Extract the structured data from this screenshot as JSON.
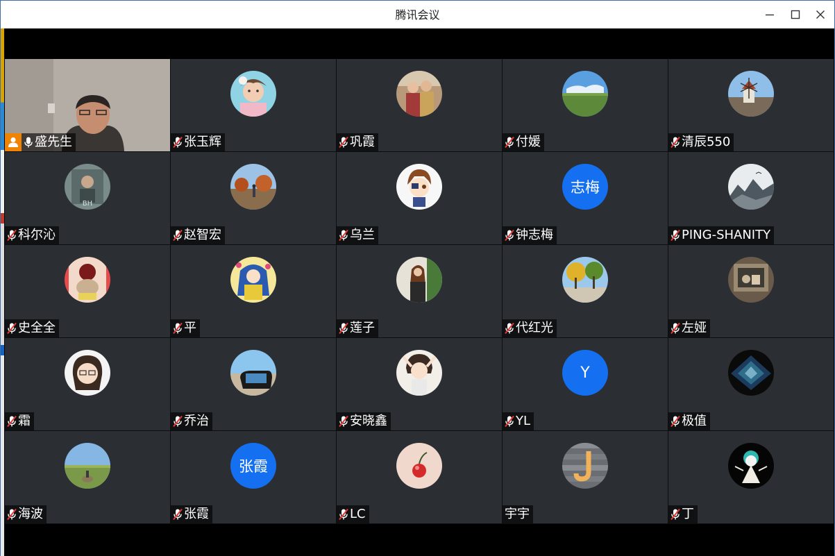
{
  "window": {
    "title": "腾讯会议"
  },
  "colors": {
    "tile_bg": "#2b2e33",
    "accent_blue": "#1470f0",
    "host_orange": "#f08300",
    "mute_red": "#e53935"
  },
  "participants": [
    {
      "name": "盛先生",
      "type": "video",
      "muted": false,
      "host": true
    },
    {
      "name": "张玉辉",
      "type": "photo",
      "muted": true
    },
    {
      "name": "巩霞",
      "type": "photo",
      "muted": true
    },
    {
      "name": "付媛",
      "type": "photo",
      "muted": true
    },
    {
      "name": "清辰550",
      "type": "photo",
      "muted": true
    },
    {
      "name": "科尔沁",
      "type": "photo",
      "muted": true
    },
    {
      "name": "赵智宏",
      "type": "photo",
      "muted": true
    },
    {
      "name": "乌兰",
      "type": "photo",
      "muted": true
    },
    {
      "name": "钟志梅",
      "type": "text",
      "avatar_text": "志梅",
      "muted": true
    },
    {
      "name": "PING-SHANITY",
      "type": "photo",
      "muted": true
    },
    {
      "name": "史全全",
      "type": "photo",
      "muted": true
    },
    {
      "name": "平",
      "type": "photo",
      "muted": true
    },
    {
      "name": "莲子",
      "type": "photo",
      "muted": true
    },
    {
      "name": "代红光",
      "type": "photo",
      "muted": true
    },
    {
      "name": "左娅",
      "type": "photo",
      "muted": true
    },
    {
      "name": "霜",
      "type": "photo",
      "muted": true
    },
    {
      "name": "乔治",
      "type": "photo",
      "muted": true
    },
    {
      "name": "安晓鑫",
      "type": "photo",
      "muted": true
    },
    {
      "name": "YL",
      "type": "text",
      "avatar_text": "Y",
      "muted": true
    },
    {
      "name": "极值",
      "type": "photo",
      "muted": true
    },
    {
      "name": "海波",
      "type": "photo",
      "muted": true
    },
    {
      "name": "张霞",
      "type": "text",
      "avatar_text": "张霞",
      "muted": true
    },
    {
      "name": "LC",
      "type": "photo",
      "muted": true
    },
    {
      "name": "宇宇",
      "type": "photo",
      "muted": false
    },
    {
      "name": "丁",
      "type": "photo",
      "muted": true
    }
  ]
}
